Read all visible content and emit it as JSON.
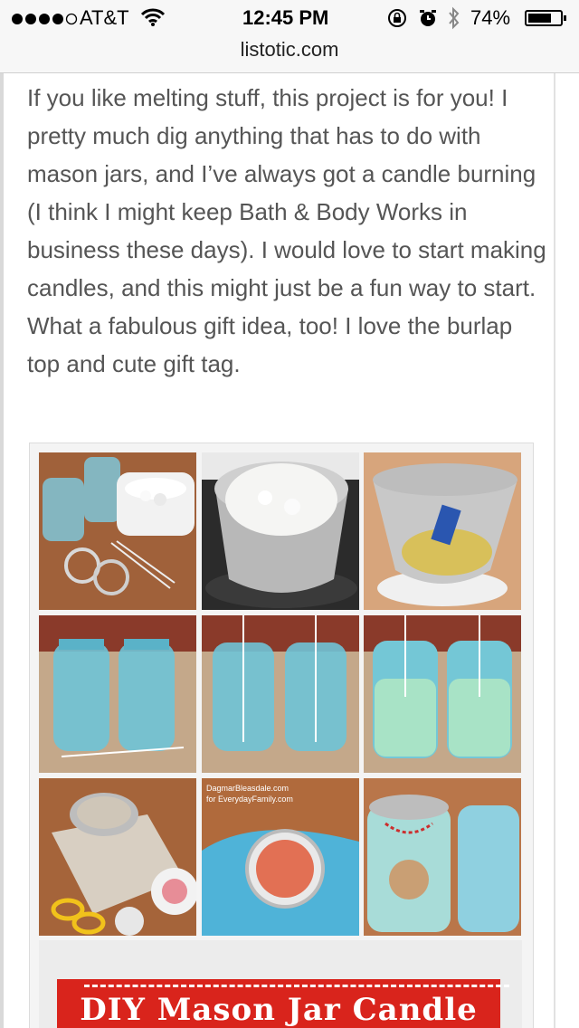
{
  "status_bar": {
    "carrier": "AT&T",
    "time": "12:45 PM",
    "battery": "74%",
    "battery_level": 0.74,
    "icons": [
      "signal-dots-icon",
      "wifi-icon",
      "rotation-lock-icon",
      "alarm-icon",
      "bluetooth-icon",
      "battery-icon"
    ]
  },
  "address_bar": {
    "domain": "listotic.com"
  },
  "article": {
    "paragraph": "If you like melting stuff, this project is for you! I pretty much dig anything that has to do with mason jars, and I’ve always got a candle burning (I think I might keep Bath & Body Works in business these days). I would love to start making candles, and this might just be a fun way to start. What a fabulous gift idea, too! I love the burlap top and cute gift tag."
  },
  "collage": {
    "watermark_line1": "DagmarBleasdale.com",
    "watermark_line2": "for EverydayFamily.com",
    "banner_title": "DIY Mason Jar Candle"
  },
  "colors": {
    "jar_blue": "#7fc6d8",
    "wax_mint": "#a8e3c6",
    "banner_red": "#d9241c",
    "text_gray": "#555555"
  }
}
